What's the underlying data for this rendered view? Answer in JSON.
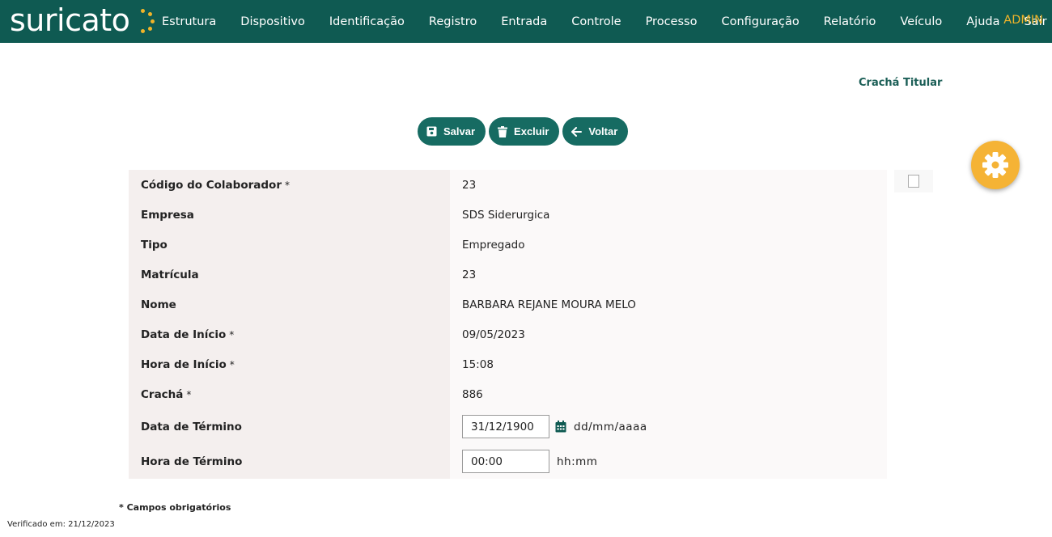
{
  "app": {
    "logo": "suricato",
    "nav": [
      "Estrutura",
      "Dispositivo",
      "Identificação",
      "Registro",
      "Entrada",
      "Controle",
      "Processo",
      "Configuração",
      "Relatório",
      "Veículo",
      "Ajuda",
      "Sair"
    ],
    "user": "ADMIN",
    "accent": "#0f5a52",
    "highlight": "#f0b429"
  },
  "page": {
    "title": "Crachá Titular",
    "buttons": {
      "save": "Salvar",
      "delete": "Excluir",
      "back": "Voltar"
    }
  },
  "form": {
    "rows": [
      {
        "label": "Código do Colaborador",
        "required": true,
        "value": "23"
      },
      {
        "label": "Empresa",
        "required": false,
        "value": "SDS Siderurgica"
      },
      {
        "label": "Tipo",
        "required": false,
        "value": "Empregado"
      },
      {
        "label": "Matrícula",
        "required": false,
        "value": "23"
      },
      {
        "label": "Nome",
        "required": false,
        "value": "BARBARA REJANE MOURA MELO"
      },
      {
        "label": "Data de Início",
        "required": true,
        "value": "09/05/2023"
      },
      {
        "label": "Hora de Início",
        "required": true,
        "value": "15:08"
      },
      {
        "label": "Crachá",
        "required": true,
        "value": "886"
      }
    ],
    "end_date": {
      "label": "Data de Término",
      "value": "31/12/1900",
      "hint": "dd/mm/aaaa"
    },
    "end_time": {
      "label": "Hora de Término",
      "value": "00:00",
      "hint": "hh:mm"
    },
    "required_marker": "*"
  },
  "footer": {
    "required_note": "* Campos obrigatórios",
    "verified": "Verificado em: 21/12/2023"
  }
}
